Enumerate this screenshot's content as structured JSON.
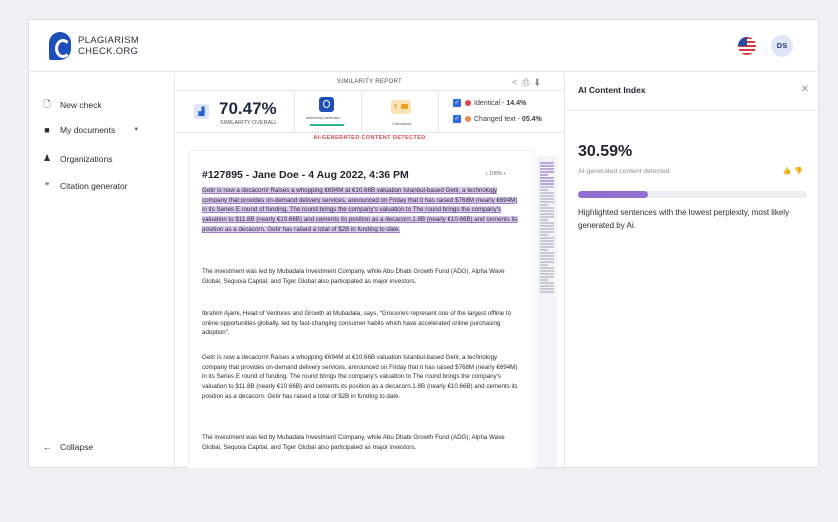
{
  "brand": {
    "line1": "PLAGIARISM",
    "line2": "CHECK.ORG"
  },
  "user": {
    "initials": "DS"
  },
  "sidebar": {
    "items": [
      {
        "label": "New check",
        "icon": "file-icon"
      },
      {
        "label": "My documents",
        "icon": "folder-icon"
      },
      {
        "label": "Organizations",
        "icon": "people-icon"
      },
      {
        "label": "Citation generator",
        "icon": "quote-icon"
      }
    ],
    "collapse_label": "Collapse"
  },
  "report": {
    "header": "SIMILARITY REPORT",
    "similarity_value": "70.47%",
    "similarity_label": "SIMILARITY OVERALL",
    "authorship_label": "Authorship verification",
    "comments_count": "3",
    "comments_label": "Comments",
    "identical_label": "Identical -",
    "identical_value": "14.4%",
    "changed_label": "Changed text -",
    "changed_value": "05.4%",
    "ai_tag": "AI-GENERATED CONTENT DETECTED",
    "zoom": "100%",
    "colors": {
      "identical": "#d9484e",
      "changed": "#f08a4b",
      "highlight": "#dcc8ee"
    }
  },
  "document": {
    "title": "#127895 - Jane Doe -  4 Aug 2022, 4:36 PM",
    "paragraphs": [
      "Getir is now a decacorn! Raises a whopping €694M at €10.66B valuation Istanbul-based Getir, a technology company that provides on-demand delivery services, announced on Friday that it has raised $768M (nearly €694M) in its Series E round of funding. The round brings the company's valuation to The round brings the company's valuation to $11.8B (nearly €10.66B) and cements its position as a decacorn.1.8B (nearly €10.66B) and cements its position as a decacorn. Getir has raised a total of $2B in funding to date.",
      "The investment was led by Mubadala Investment Company, while Abu Dhabi Growth Fund (ADG), Alpha Wave Global, Sequoia Capital, and Tiger Global also participated as major investors.",
      "Ibrahim Ajami, Head of Ventures and Growth at Mubadala, says, “Groceries represent one of the largest offline to online opportunities globally, led by fast-changing consumer habits which have accelerated online purchasing adoption”.",
      "Getir is now a decacorn! Raises a whopping €694M at €10.66B valuation Istanbul-based Getir, a technology company that provides on-demand delivery services, announced on Friday that it has raised $768M (nearly €694M) in its Series E round of funding. The round brings the company's valuation to The round brings the company's valuation to $11.8B (nearly €10.66B) and cements its position as a decacorn.1.8B (nearly €10.66B) and cements its position as a decacorn. Getir has raised a total of $2B in funding to date.",
      "The investment was led by Mubadala Investment Company, while Abu Dhabi Growth Fund (ADG), Alpha Wave Global, Sequoia Capital, and Tiger Global also participated as major investors."
    ]
  },
  "ai_panel": {
    "title": "AI Content Index",
    "percent": "30.59%",
    "percent_value": 0.3059,
    "subtitle": "AI-generated content detected",
    "description": "Highlighted sentences with the lowest perplexity, most likely generated by Ai.",
    "bar_color": "#9270d1"
  }
}
